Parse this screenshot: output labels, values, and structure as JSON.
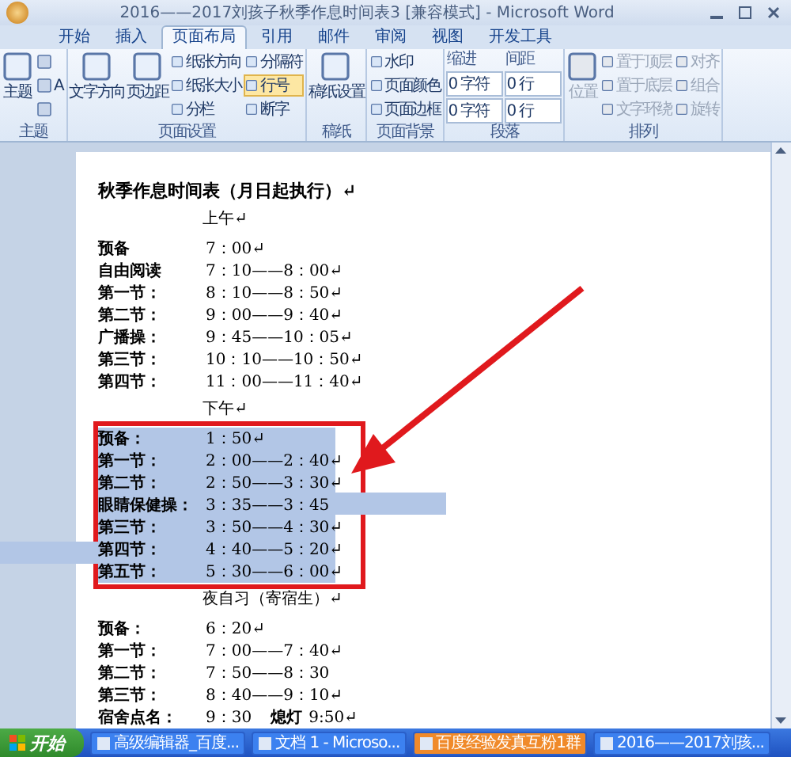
{
  "window": {
    "title": "2016——2017刘孩子秋季作息时间表3 [兼容模式] - Microsoft Word"
  },
  "tabs": [
    {
      "label": "开始",
      "selected": false
    },
    {
      "label": "插入",
      "selected": false
    },
    {
      "label": "页面布局",
      "selected": true
    },
    {
      "label": "引用",
      "selected": false
    },
    {
      "label": "邮件",
      "selected": false
    },
    {
      "label": "审阅",
      "selected": false
    },
    {
      "label": "视图",
      "selected": false
    },
    {
      "label": "开发工具",
      "selected": false
    }
  ],
  "ribbon": [
    {
      "name": "主题",
      "disabled": false,
      "columns": [
        [
          {
            "kind": "big",
            "label": "主题"
          }
        ],
        [
          {
            "kind": "icon"
          },
          {
            "kind": "icon",
            "label": "A"
          },
          {
            "kind": "icon"
          }
        ]
      ]
    },
    {
      "name": "页面设置",
      "disabled": false,
      "columns": [
        [
          {
            "kind": "big",
            "label": "文字方向"
          }
        ],
        [
          {
            "kind": "big",
            "label": "页边距"
          }
        ],
        [
          {
            "kind": "small",
            "label": "纸张方向",
            "selected": false
          },
          {
            "kind": "small",
            "label": "纸张大小",
            "selected": false
          },
          {
            "kind": "small",
            "label": "分栏",
            "selected": false
          }
        ],
        [
          {
            "kind": "small",
            "label": "分隔符",
            "selected": false
          },
          {
            "kind": "small",
            "label": "行号",
            "selected": true
          },
          {
            "kind": "small",
            "label": "断字",
            "selected": false
          }
        ]
      ]
    },
    {
      "name": "稿纸",
      "disabled": false,
      "columns": [
        [
          {
            "kind": "big",
            "label": "稿纸设置"
          }
        ]
      ]
    },
    {
      "name": "页面背景",
      "disabled": false,
      "columns": [
        [
          {
            "kind": "small",
            "label": "水印",
            "selected": false
          },
          {
            "kind": "small",
            "label": "页面颜色",
            "selected": false
          },
          {
            "kind": "small",
            "label": "页面边框",
            "selected": false
          }
        ]
      ]
    },
    {
      "name": "段落",
      "disabled": false,
      "columns": [
        [
          {
            "kind": "caption",
            "label": "缩进"
          },
          {
            "kind": "spin",
            "label": "0 字符"
          },
          {
            "kind": "spin",
            "label": "0 字符"
          }
        ],
        [
          {
            "kind": "caption",
            "label": "间距"
          },
          {
            "kind": "spin",
            "label": "0 行"
          },
          {
            "kind": "spin",
            "label": "0 行"
          }
        ]
      ]
    },
    {
      "name": "排列",
      "disabled": true,
      "columns": [
        [
          {
            "kind": "big",
            "label": "位置"
          }
        ],
        [
          {
            "kind": "small",
            "label": "置于顶层",
            "selected": false
          },
          {
            "kind": "small",
            "label": "置于底层",
            "selected": false
          },
          {
            "kind": "small",
            "label": "文字环绕",
            "selected": false
          }
        ],
        [
          {
            "kind": "small",
            "label": "对齐",
            "selected": false
          },
          {
            "kind": "small",
            "label": "组合",
            "selected": false
          },
          {
            "kind": "small",
            "label": "旋转",
            "selected": false
          }
        ]
      ]
    }
  ],
  "document": {
    "title": "秋季作息时间表（月日起执行）↵",
    "sections": [
      {
        "heading": "上午↵",
        "highlighted": false,
        "rows": [
          {
            "label": "预备",
            "time": "7：00↵",
            "selected": false
          },
          {
            "label": "自由阅读",
            "time": "7：10——8：00↵",
            "selected": false
          },
          {
            "label": "第一节：",
            "time": "8：10——8：50↵",
            "selected": false
          },
          {
            "label": "第二节：",
            "time": "9：00——9：40↵",
            "selected": false
          },
          {
            "label": "广播操：",
            "time": "9：45——10：05↵",
            "selected": false
          },
          {
            "label": "第三节：",
            "time": "10：10——10：50↵",
            "selected": false
          },
          {
            "label": "第四节：",
            "time": "11：00——11：40↵",
            "selected": false
          }
        ]
      },
      {
        "heading": "下午↵",
        "highlighted": true,
        "rows": [
          {
            "label": "预备：",
            "time": "1：50↵",
            "selected": true,
            "extends_right": false,
            "extends_left": false
          },
          {
            "label": "第一节：",
            "time": "2：00——2：40↵",
            "selected": true,
            "extends_right": false,
            "extends_left": false
          },
          {
            "label": "第二节：",
            "time": "2：50——3：30↵",
            "selected": true,
            "extends_right": false,
            "extends_left": false
          },
          {
            "label": "眼睛保健操：",
            "time": "3：35——3：45",
            "selected": true,
            "extends_right": true,
            "extends_left": false
          },
          {
            "label": "第三节：",
            "time": "3：50——4：30↵",
            "selected": true,
            "extends_right": false,
            "extends_left": false
          },
          {
            "label": "第四节：",
            "time": "4：40——5：20↵",
            "selected": true,
            "extends_right": false,
            "extends_left": true
          },
          {
            "label": "第五节：",
            "time": "5：30——6：00↵",
            "selected": true,
            "extends_right": false,
            "extends_left": false
          }
        ]
      },
      {
        "heading": "夜自习（寄宿生）↵",
        "highlighted": false,
        "rows": [
          {
            "label": "预备：",
            "time": "6：20↵",
            "selected": false
          },
          {
            "label": "第一节：",
            "time": "7：00——7：40↵",
            "selected": false
          },
          {
            "label": "第二节：",
            "time": "7：50——8：30",
            "selected": false
          },
          {
            "label": "第三节：",
            "time": "8：40——9：10↵",
            "selected": false
          },
          {
            "label": "宿舍点名：",
            "time": "9：30",
            "extra_label": "熄灯",
            "extra_time": "9:50↵",
            "selected": false
          }
        ]
      }
    ]
  },
  "taskbar": {
    "start": "开始",
    "items": [
      {
        "label": "高级编辑器_百度...",
        "selected": false
      },
      {
        "label": "文档 1 - Microso...",
        "selected": false
      },
      {
        "label": "百度经验发真互粉1群",
        "selected": true
      },
      {
        "label": "2016——2017刘孩...",
        "selected": false
      }
    ]
  }
}
